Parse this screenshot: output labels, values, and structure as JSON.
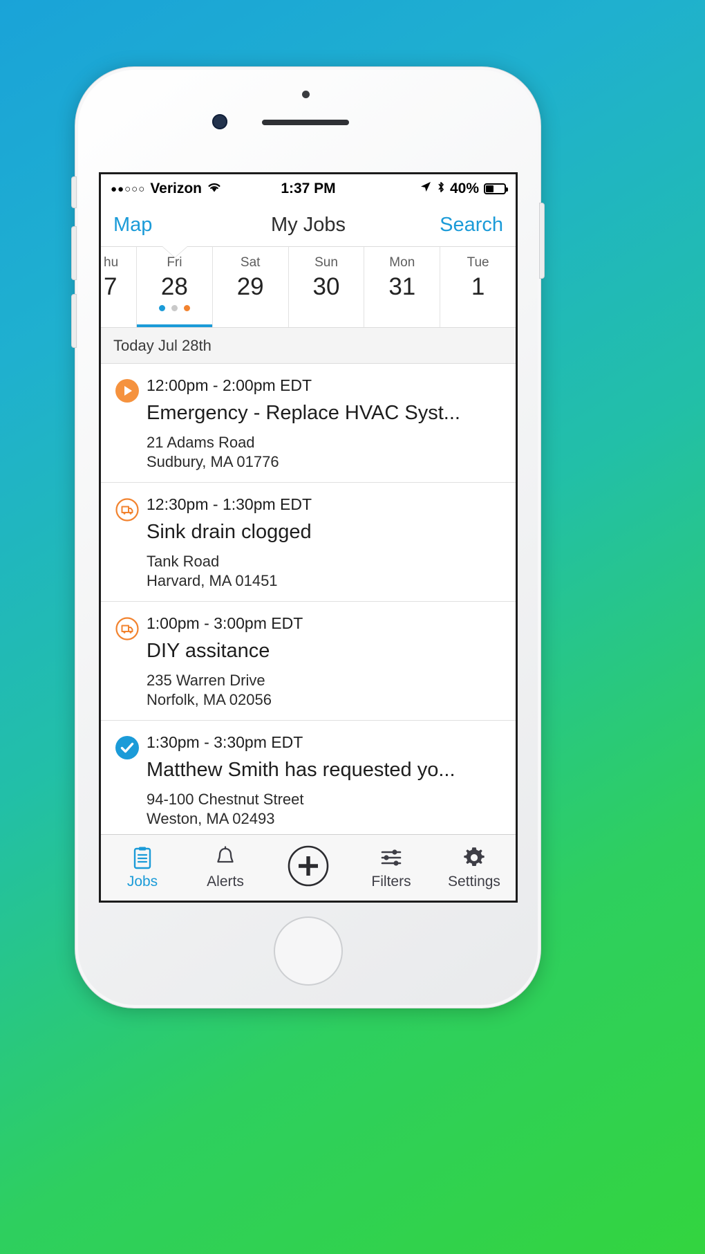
{
  "colors": {
    "accent_blue": "#1b9bd8",
    "accent_orange": "#f2832f",
    "text_dark": "#1d1d1d",
    "bg_gray": "#f4f4f4",
    "wallpaper_top": "#1aa3d8",
    "wallpaper_bottom": "#33d43f"
  },
  "status_bar": {
    "carrier": "Verizon",
    "signal_dots": "●●○○○",
    "wifi_icon": "wifi-icon",
    "time": "1:37 PM",
    "location_icon": "location-arrow-icon",
    "bluetooth_icon": "bluetooth-icon",
    "battery_percent": "40%",
    "battery_level": 40
  },
  "nav_bar": {
    "left_label": "Map",
    "title": "My Jobs",
    "right_label": "Search"
  },
  "date_strip": {
    "selected_index": 1,
    "days": [
      {
        "name": "hu",
        "number": "7",
        "partial": true,
        "dots": []
      },
      {
        "name": "Fri",
        "number": "28",
        "partial": false,
        "dots": [
          "#1b9bd8",
          "#c9c9c9",
          "#f2832f"
        ]
      },
      {
        "name": "Sat",
        "number": "29",
        "partial": false,
        "dots": []
      },
      {
        "name": "Sun",
        "number": "30",
        "partial": false,
        "dots": []
      },
      {
        "name": "Mon",
        "number": "31",
        "partial": false,
        "dots": []
      },
      {
        "name": "Tue",
        "number": "1",
        "partial": false,
        "dots": []
      }
    ]
  },
  "section_header": "Today Jul 28th",
  "jobs": [
    {
      "icon": "play-circle-filled-icon",
      "icon_style": "orange-filled",
      "time": "12:00pm - 2:00pm EDT",
      "title": "Emergency - Replace HVAC Syst...",
      "address_line1": "21 Adams Road",
      "address_line2": "Sudbury, MA 01776"
    },
    {
      "icon": "van-circle-outline-icon",
      "icon_style": "orange-outline",
      "time": "12:30pm - 1:30pm EDT",
      "title": "Sink drain clogged",
      "address_line1": " Tank Road",
      "address_line2": "Harvard, MA 01451"
    },
    {
      "icon": "van-circle-outline-icon",
      "icon_style": "orange-outline",
      "time": "1:00pm - 3:00pm EDT",
      "title": "DIY assitance",
      "address_line1": "235 Warren Drive",
      "address_line2": "Norfolk, MA 02056"
    },
    {
      "icon": "check-circle-filled-icon",
      "icon_style": "blue-filled",
      "time": "1:30pm - 3:30pm EDT",
      "title": "Matthew Smith has requested yo...",
      "address_line1": "94-100 Chestnut Street",
      "address_line2": "Weston, MA 02493"
    }
  ],
  "tab_bar": {
    "active_index": 0,
    "tabs": [
      {
        "label": "Jobs",
        "icon": "clipboard-icon"
      },
      {
        "label": "Alerts",
        "icon": "bell-icon"
      },
      {
        "label": "",
        "icon": "plus-circle-icon"
      },
      {
        "label": "Filters",
        "icon": "sliders-icon"
      },
      {
        "label": "Settings",
        "icon": "gear-icon"
      }
    ]
  }
}
